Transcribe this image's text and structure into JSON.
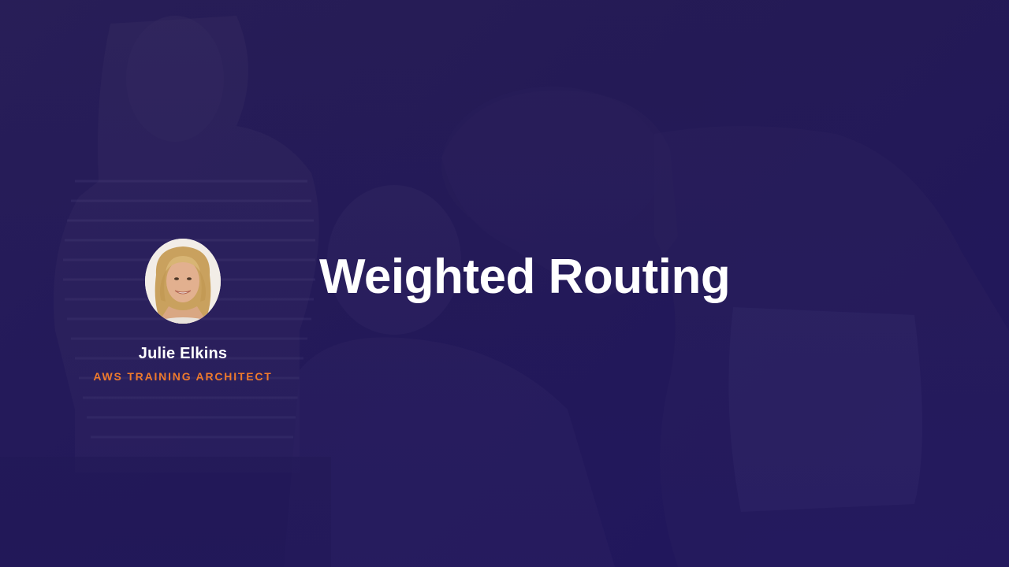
{
  "slide": {
    "title": "Weighted Routing",
    "presenter": {
      "name": "Julie Elkins",
      "role": "AWS TRAINING ARCHITECT"
    }
  },
  "colors": {
    "background": "#241b52",
    "title": "#ffffff",
    "role_accent": "#ee7a2c"
  },
  "icons": {
    "avatar": "presenter-avatar"
  }
}
